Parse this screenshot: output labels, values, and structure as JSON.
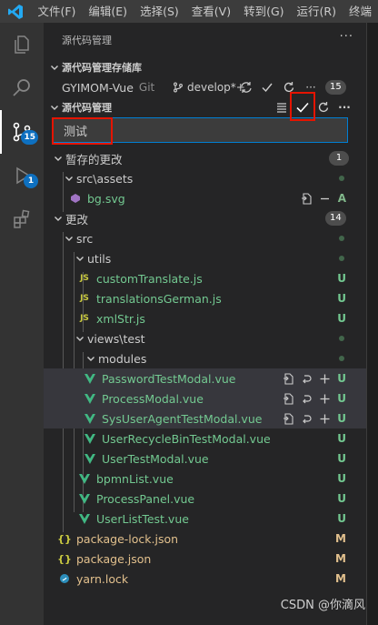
{
  "menu": [
    "文件(F)",
    "编辑(E)",
    "选择(S)",
    "查看(V)",
    "转到(G)",
    "运行(R)",
    "终端"
  ],
  "activity": {
    "scm_badge": "15",
    "debug_badge": "1"
  },
  "sidebar": {
    "title": "源代码管理",
    "repos_section": "源代码管理存储库",
    "repo": {
      "name": "GYIMOM-Vue",
      "type": "Git",
      "branch": "develop*+",
      "count": "15"
    },
    "scm_section": "源代码管理"
  },
  "commit_input": {
    "value": "测试"
  },
  "staged": {
    "label": "暂存的更改",
    "count": "1",
    "folder": "src\\assets",
    "file": {
      "name": "bg.svg",
      "status": "A"
    }
  },
  "changes": {
    "label": "更改",
    "count": "14",
    "src": "src",
    "utils": "utils",
    "utils_files": [
      {
        "name": "customTranslate.js",
        "status": "U"
      },
      {
        "name": "translationsGerman.js",
        "status": "U"
      },
      {
        "name": "xmlStr.js",
        "status": "U"
      }
    ],
    "views_test": "views\\test",
    "modules": "modules",
    "module_files": [
      {
        "name": "PasswordTestModal.vue",
        "status": "U"
      },
      {
        "name": "ProcessModal.vue",
        "status": "U"
      },
      {
        "name": "SysUserAgentTestModal.vue",
        "status": "U"
      },
      {
        "name": "UserRecycleBinTestModal.vue",
        "status": "U"
      },
      {
        "name": "UserTestModal.vue",
        "status": "U"
      }
    ],
    "test_files": [
      {
        "name": "bpmnList.vue",
        "status": "U"
      },
      {
        "name": "ProcessPanel.vue",
        "status": "U"
      },
      {
        "name": "UserListTest.vue",
        "status": "U"
      }
    ],
    "root_files": [
      {
        "name": "package-lock.json",
        "status": "M"
      },
      {
        "name": "package.json",
        "status": "M"
      },
      {
        "name": "yarn.lock",
        "status": "M"
      }
    ]
  },
  "watermark": "CSDN @你滴风",
  "colors": {
    "accent": "#007fd4",
    "highlight": "#e51400",
    "untracked": "#73c991",
    "modified": "#e2c08d"
  }
}
